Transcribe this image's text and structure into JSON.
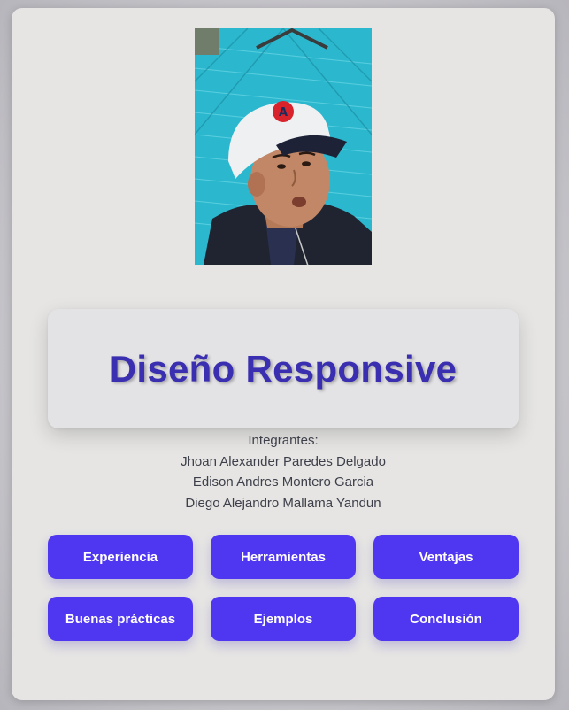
{
  "title": "Diseño Responsive",
  "members": {
    "heading": "Integrantes:",
    "names": [
      "Jhoan Alexander Paredes Delgado",
      "Edison Andres Montero Garcia",
      "Diego Alejandro Mallama Yandun"
    ]
  },
  "buttons": [
    "Experiencia",
    "Herramientas",
    "Ventajas",
    "Buenas prácticas",
    "Ejemplos",
    "Conclusión"
  ],
  "colors": {
    "accent": "#4f36f0",
    "title": "#3a2fb0",
    "card": "#e6e5e3"
  }
}
